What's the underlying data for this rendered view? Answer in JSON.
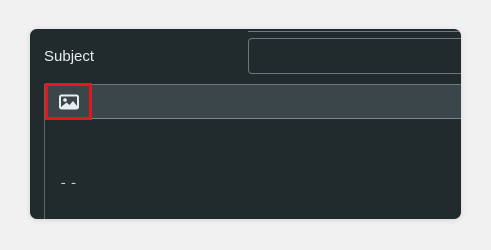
{
  "form": {
    "subject_label": "Subject",
    "subject_value": ""
  },
  "toolbar": {
    "image_button_icon": "image-icon"
  },
  "editor": {
    "body_text": "--"
  },
  "colors": {
    "panel_background": "#212a2d",
    "toolbar_background": "#3a4649",
    "highlight_border": "#e0191e"
  }
}
